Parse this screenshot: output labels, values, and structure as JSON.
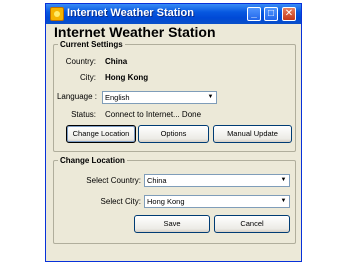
{
  "window": {
    "title": "Internet Weather Station",
    "minimize_glyph": "_",
    "maximize_glyph": "□",
    "close_glyph": "✕"
  },
  "heading": "Internet Weather Station",
  "current_settings": {
    "legend": "Current Settings",
    "country_label": "Country:",
    "country_value": "China",
    "city_label": "City:",
    "city_value": "Hong Kong",
    "language_label": "Language :",
    "language_value": "English",
    "status_label": "Status:",
    "status_value": "Connect to Internet... Done",
    "buttons": {
      "change_location": "Change Location",
      "options": "Options",
      "manual_update": "Manual Update"
    }
  },
  "change_location": {
    "legend": "Change Location",
    "country_label": "Select Country:",
    "country_value": "China",
    "city_label": "Select City:",
    "city_value": "Hong Kong",
    "save": "Save",
    "cancel": "Cancel"
  },
  "dropdown_glyph": "▼"
}
